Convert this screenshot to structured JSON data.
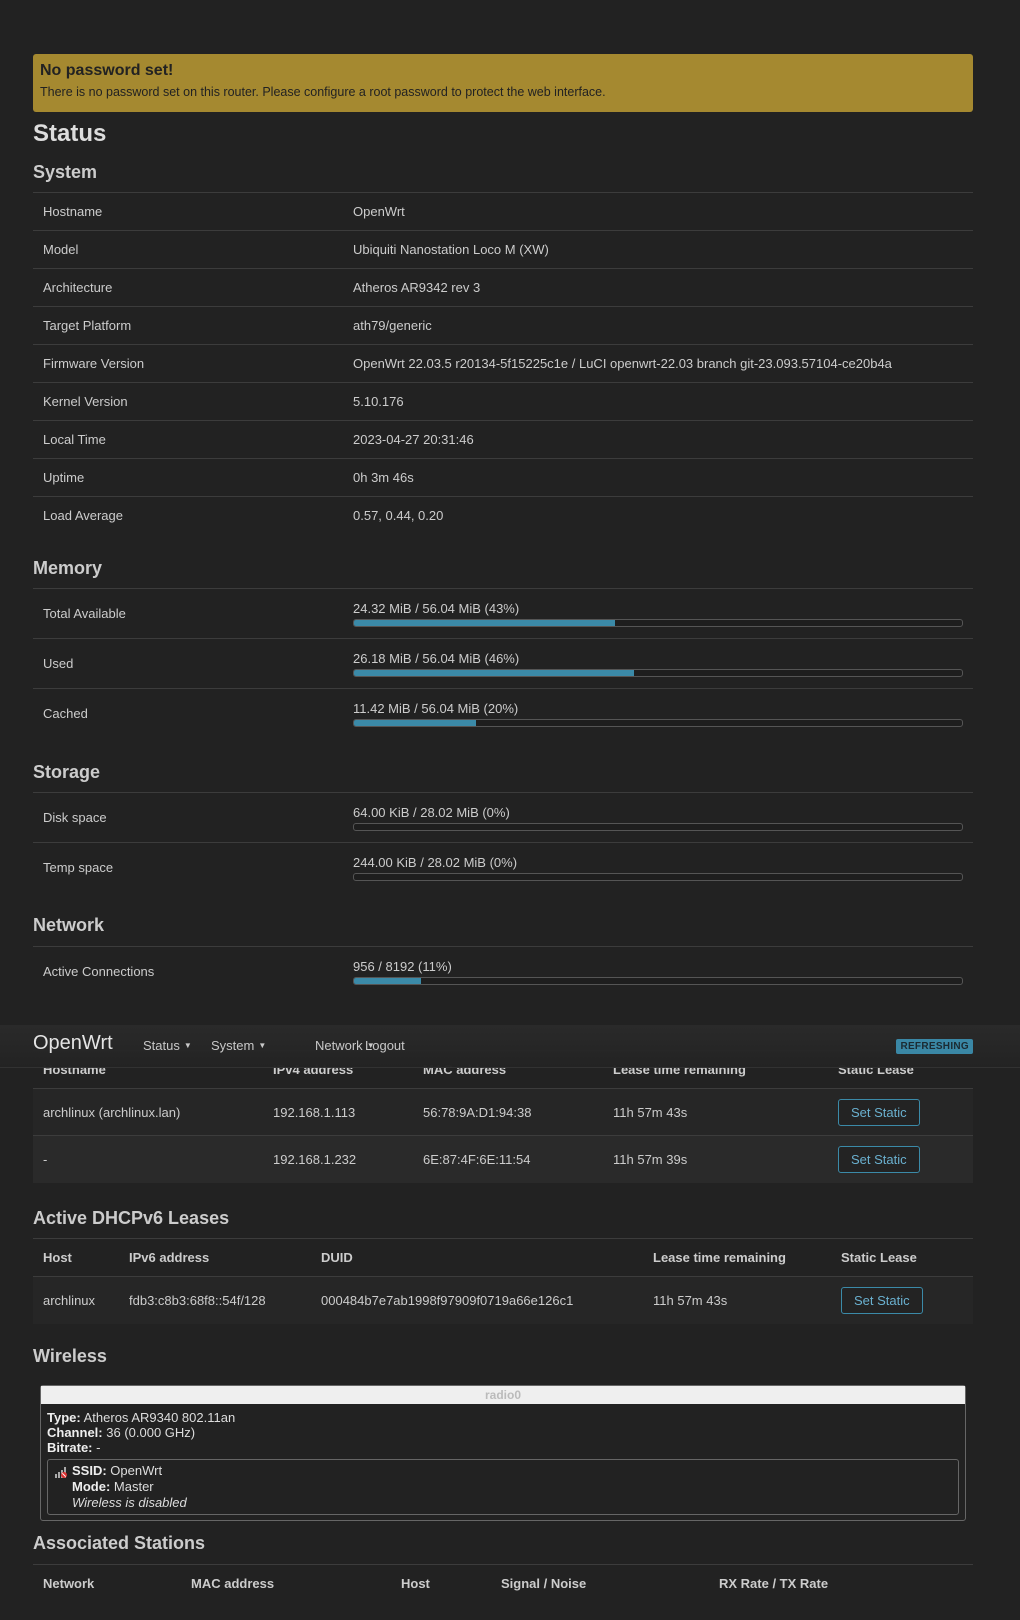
{
  "alert": {
    "title": "No password set!",
    "message": "There is no password set on this router. Please configure a root password to protect the web interface."
  },
  "page_title": "Status",
  "system": {
    "heading": "System",
    "rows": [
      {
        "key": "Hostname",
        "value": "OpenWrt"
      },
      {
        "key": "Model",
        "value": "Ubiquiti Nanostation Loco M (XW)"
      },
      {
        "key": "Architecture",
        "value": "Atheros AR9342 rev 3"
      },
      {
        "key": "Target Platform",
        "value": "ath79/generic"
      },
      {
        "key": "Firmware Version",
        "value": "OpenWrt 22.03.5 r20134-5f15225c1e / LuCI openwrt-22.03 branch git-23.093.57104-ce20b4a"
      },
      {
        "key": "Kernel Version",
        "value": "5.10.176"
      },
      {
        "key": "Local Time",
        "value": "2023-04-27 20:31:46"
      },
      {
        "key": "Uptime",
        "value": "0h 3m 46s"
      },
      {
        "key": "Load Average",
        "value": "0.57, 0.44, 0.20"
      }
    ]
  },
  "memory": {
    "heading": "Memory",
    "rows": [
      {
        "key": "Total Available",
        "label": "24.32 MiB / 56.04 MiB (43%)",
        "percent": 43
      },
      {
        "key": "Used",
        "label": "26.18 MiB / 56.04 MiB (46%)",
        "percent": 46
      },
      {
        "key": "Cached",
        "label": "11.42 MiB / 56.04 MiB (20%)",
        "percent": 20
      }
    ]
  },
  "storage": {
    "heading": "Storage",
    "rows": [
      {
        "key": "Disk space",
        "label": "64.00 KiB / 28.02 MiB (0%)",
        "percent": 0
      },
      {
        "key": "Temp space",
        "label": "244.00 KiB / 28.02 MiB (0%)",
        "percent": 0
      }
    ]
  },
  "network": {
    "heading": "Network",
    "rows": [
      {
        "key": "Active Connections",
        "label": "956 / 8192 (11%)",
        "percent": 11
      }
    ]
  },
  "navbar": {
    "brand": "OpenWrt",
    "items": [
      "Status",
      "System",
      "Network",
      "Logout"
    ],
    "badge": "REFRESHING"
  },
  "dhcp4": {
    "columns": [
      "Hostname",
      "IPv4 address",
      "MAC address",
      "Lease time remaining",
      "Static Lease"
    ],
    "rows": [
      {
        "host": "archlinux (archlinux.lan)",
        "ip": "192.168.1.113",
        "mac": "56:78:9A:D1:94:38",
        "lease": "11h 57m 43s",
        "action": "Set Static"
      },
      {
        "host": "-",
        "ip": "192.168.1.232",
        "mac": "6E:87:4F:6E:11:54",
        "lease": "11h 57m 39s",
        "action": "Set Static"
      }
    ]
  },
  "dhcp6": {
    "heading": "Active DHCPv6 Leases",
    "columns": [
      "Host",
      "IPv6 address",
      "DUID",
      "Lease time remaining",
      "Static Lease"
    ],
    "rows": [
      {
        "host": "archlinux",
        "ip": "fdb3:c8b3:68f8::54f/128",
        "duid": "000484b7e7ab1998f97909f0719a66e126c1",
        "lease": "11h 57m 43s",
        "action": "Set Static"
      }
    ]
  },
  "wireless": {
    "heading": "Wireless",
    "radio": "radio0",
    "type_label": "Type:",
    "type_value": "Atheros AR9340 802.11an",
    "channel_label": "Channel:",
    "channel_value": "36 (0.000 GHz)",
    "bitrate_label": "Bitrate:",
    "bitrate_value": "-",
    "ssid_label": "SSID:",
    "ssid_value": "OpenWrt",
    "mode_label": "Mode:",
    "mode_value": "Master",
    "status": "Wireless is disabled"
  },
  "stations": {
    "heading": "Associated Stations",
    "columns": [
      "Network",
      "MAC address",
      "Host",
      "Signal / Noise",
      "RX Rate / TX Rate"
    ]
  },
  "colors": {
    "accent": "#3b8aa8",
    "alert": "#a58930",
    "background": "#222222"
  }
}
